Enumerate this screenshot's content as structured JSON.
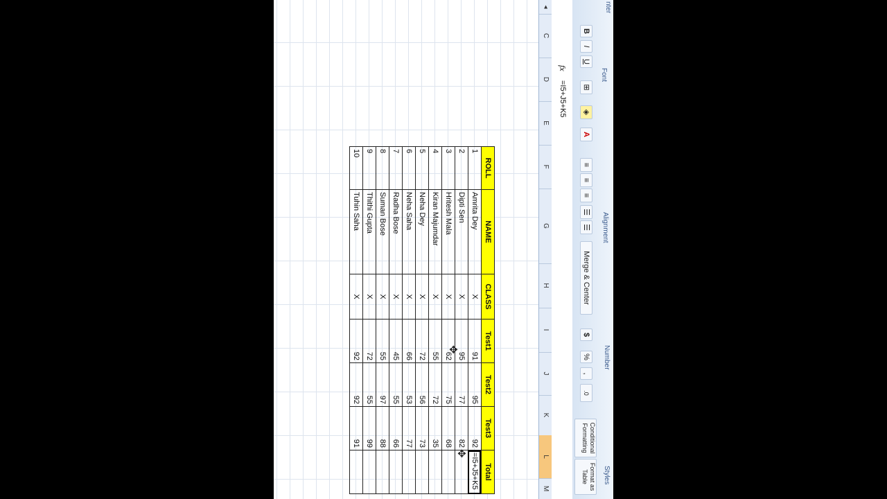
{
  "ribbon": {
    "font": {
      "label": "Font",
      "bold": "B",
      "italic": "I",
      "underline": "U"
    },
    "alignment": {
      "label": "Alignment",
      "merge_center": "Merge & Center"
    },
    "number": {
      "label": "Number",
      "currency": "$",
      "percent": "%",
      "comma": ","
    },
    "styles": {
      "label": "Styles",
      "conditional_formatting": "Conditional Formatting",
      "format_as_table": "Format as Table"
    },
    "partial_label": "nter"
  },
  "formula_bar": {
    "fx": "fx",
    "formula": "=I5+J5+K5"
  },
  "columns": [
    "C",
    "D",
    "E",
    "F",
    "G",
    "H",
    "I",
    "J",
    "K",
    "L",
    "M"
  ],
  "selected_column": "L",
  "table": {
    "headers": [
      "ROLL",
      "NAME",
      "CLASS",
      "Test1",
      "Test2",
      "Test3",
      "Total"
    ],
    "rows": [
      {
        "roll": "1",
        "name": "Amrita Dey",
        "class": "X",
        "t1": "91",
        "t2": "95",
        "t3": "92",
        "total": "=I5+J5+K5"
      },
      {
        "roll": "2",
        "name": "Dipti Sen",
        "class": "X",
        "t1": "95",
        "t2": "77",
        "t3": "82",
        "total": ""
      },
      {
        "roll": "3",
        "name": "Hritesh Mala",
        "class": "X",
        "t1": "62",
        "t2": "75",
        "t3": "68",
        "total": ""
      },
      {
        "roll": "4",
        "name": "Kiran Majumdar",
        "class": "X",
        "t1": "55",
        "t2": "72",
        "t3": "35",
        "total": ""
      },
      {
        "roll": "5",
        "name": "Neha Dey",
        "class": "X",
        "t1": "72",
        "t2": "56",
        "t3": "73",
        "total": ""
      },
      {
        "roll": "6",
        "name": "Neha Saha",
        "class": "X",
        "t1": "66",
        "t2": "53",
        "t3": "77",
        "total": ""
      },
      {
        "roll": "7",
        "name": "Radha Bose",
        "class": "X",
        "t1": "45",
        "t2": "55",
        "t3": "66",
        "total": ""
      },
      {
        "roll": "8",
        "name": "Suman Bose",
        "class": "X",
        "t1": "55",
        "t2": "97",
        "t3": "88",
        "total": ""
      },
      {
        "roll": "9",
        "name": "Thithi Gupta",
        "class": "X",
        "t1": "72",
        "t2": "55",
        "t3": "99",
        "total": ""
      },
      {
        "roll": "10",
        "name": "Tuhin Saha",
        "class": "X",
        "t1": "92",
        "t2": "92",
        "t3": "91",
        "total": ""
      }
    ]
  }
}
